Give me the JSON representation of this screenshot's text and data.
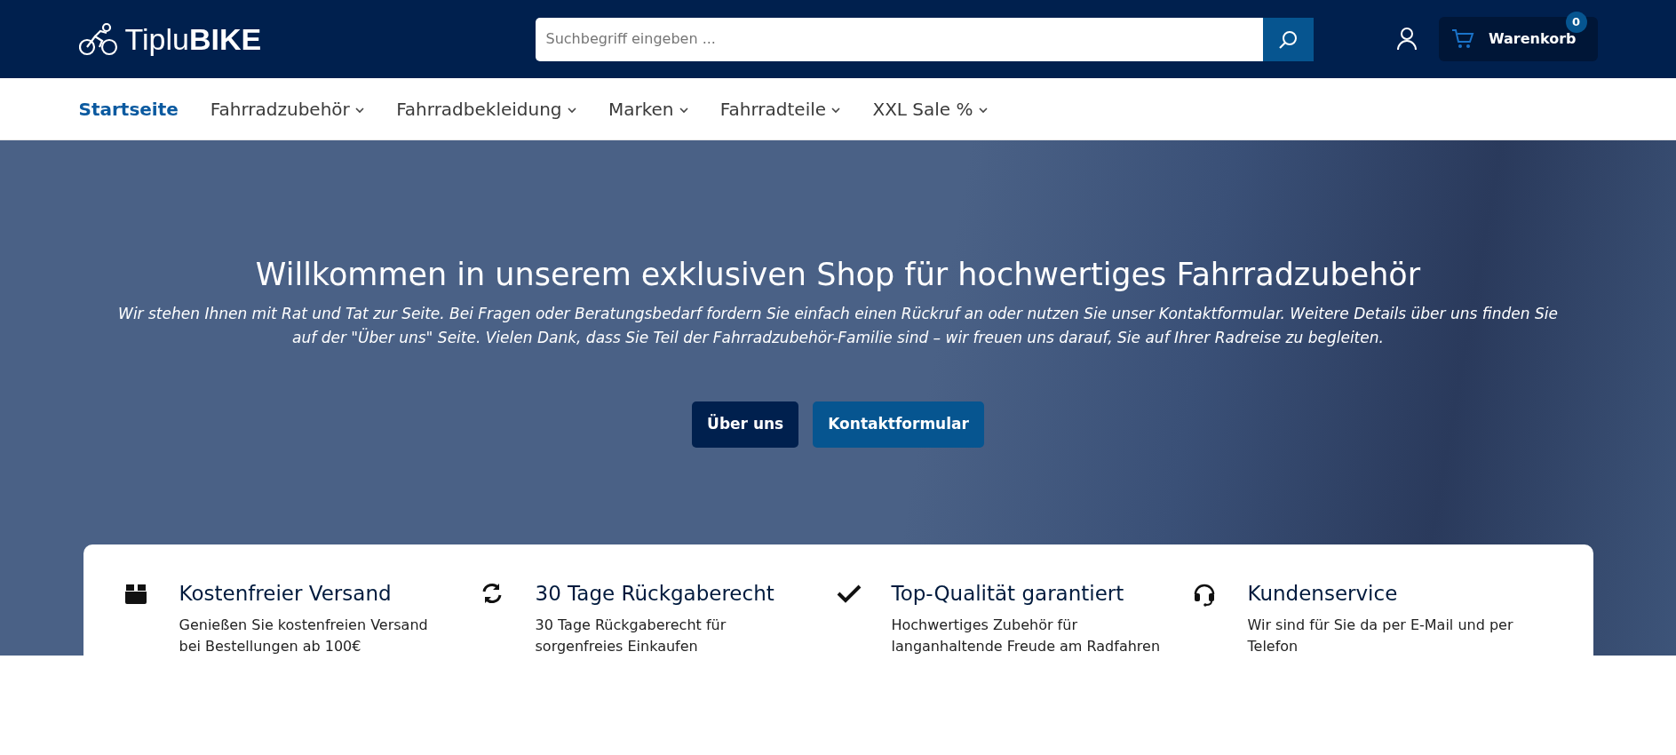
{
  "header": {
    "logo": "Tiplu**BIKE**",
    "search": {
      "placeholder": "Suchbegriff eingeben ..."
    },
    "cart": {
      "label": "Warenkorb",
      "count": "0"
    }
  },
  "nav": [
    {
      "label": "Startseite",
      "selected": true,
      "dropdown": false
    },
    {
      "label": "Fahrradzubehör",
      "selected": false,
      "dropdown": true
    },
    {
      "label": "Fahrradbekleidung",
      "selected": false,
      "dropdown": true
    },
    {
      "label": "Marken",
      "selected": false,
      "dropdown": true
    },
    {
      "label": "Fahrradteile",
      "selected": false,
      "dropdown": true
    },
    {
      "label": "XXL Sale %",
      "selected": false,
      "dropdown": true
    }
  ],
  "hero": {
    "title": "Willkommen in unserem exklusiven Shop für hochwertiges Fahrradzubehör",
    "text": "Wir stehen Ihnen mit Rat und Tat zur Seite. Bei Fragen oder Beratungsbedarf fordern Sie einfach einen Rückruf an oder nutzen Sie unser Kontaktformular. Weitere Details über uns finden Sie auf der \"Über uns\" Seite. Vielen Dank, dass Sie Teil der Fahrradzubehör-Familie sind – wir freuen uns darauf, Sie auf Ihrer Radreise zu begleiten.",
    "buttons": [
      {
        "label": "Über uns",
        "kind": "dark"
      },
      {
        "label": "Kontaktformular",
        "kind": "primary"
      }
    ]
  },
  "features": [
    {
      "title": "Kostenfreier Versand",
      "text": "Genießen Sie kostenfreien Versand bei Bestellungen ab 100€"
    },
    {
      "title": "30 Tage Rückgaberecht",
      "text": "30 Tage Rückgaberecht für sorgenfreies Einkaufen"
    },
    {
      "title": "Top-Qualität garantiert",
      "text": "Hochwertiges Zubehör für langanhaltende Freude am Radfahren"
    },
    {
      "title": "Kundenservice",
      "text": "Wir sind für Sie da per E-Mail und per Telefon"
    }
  ]
}
